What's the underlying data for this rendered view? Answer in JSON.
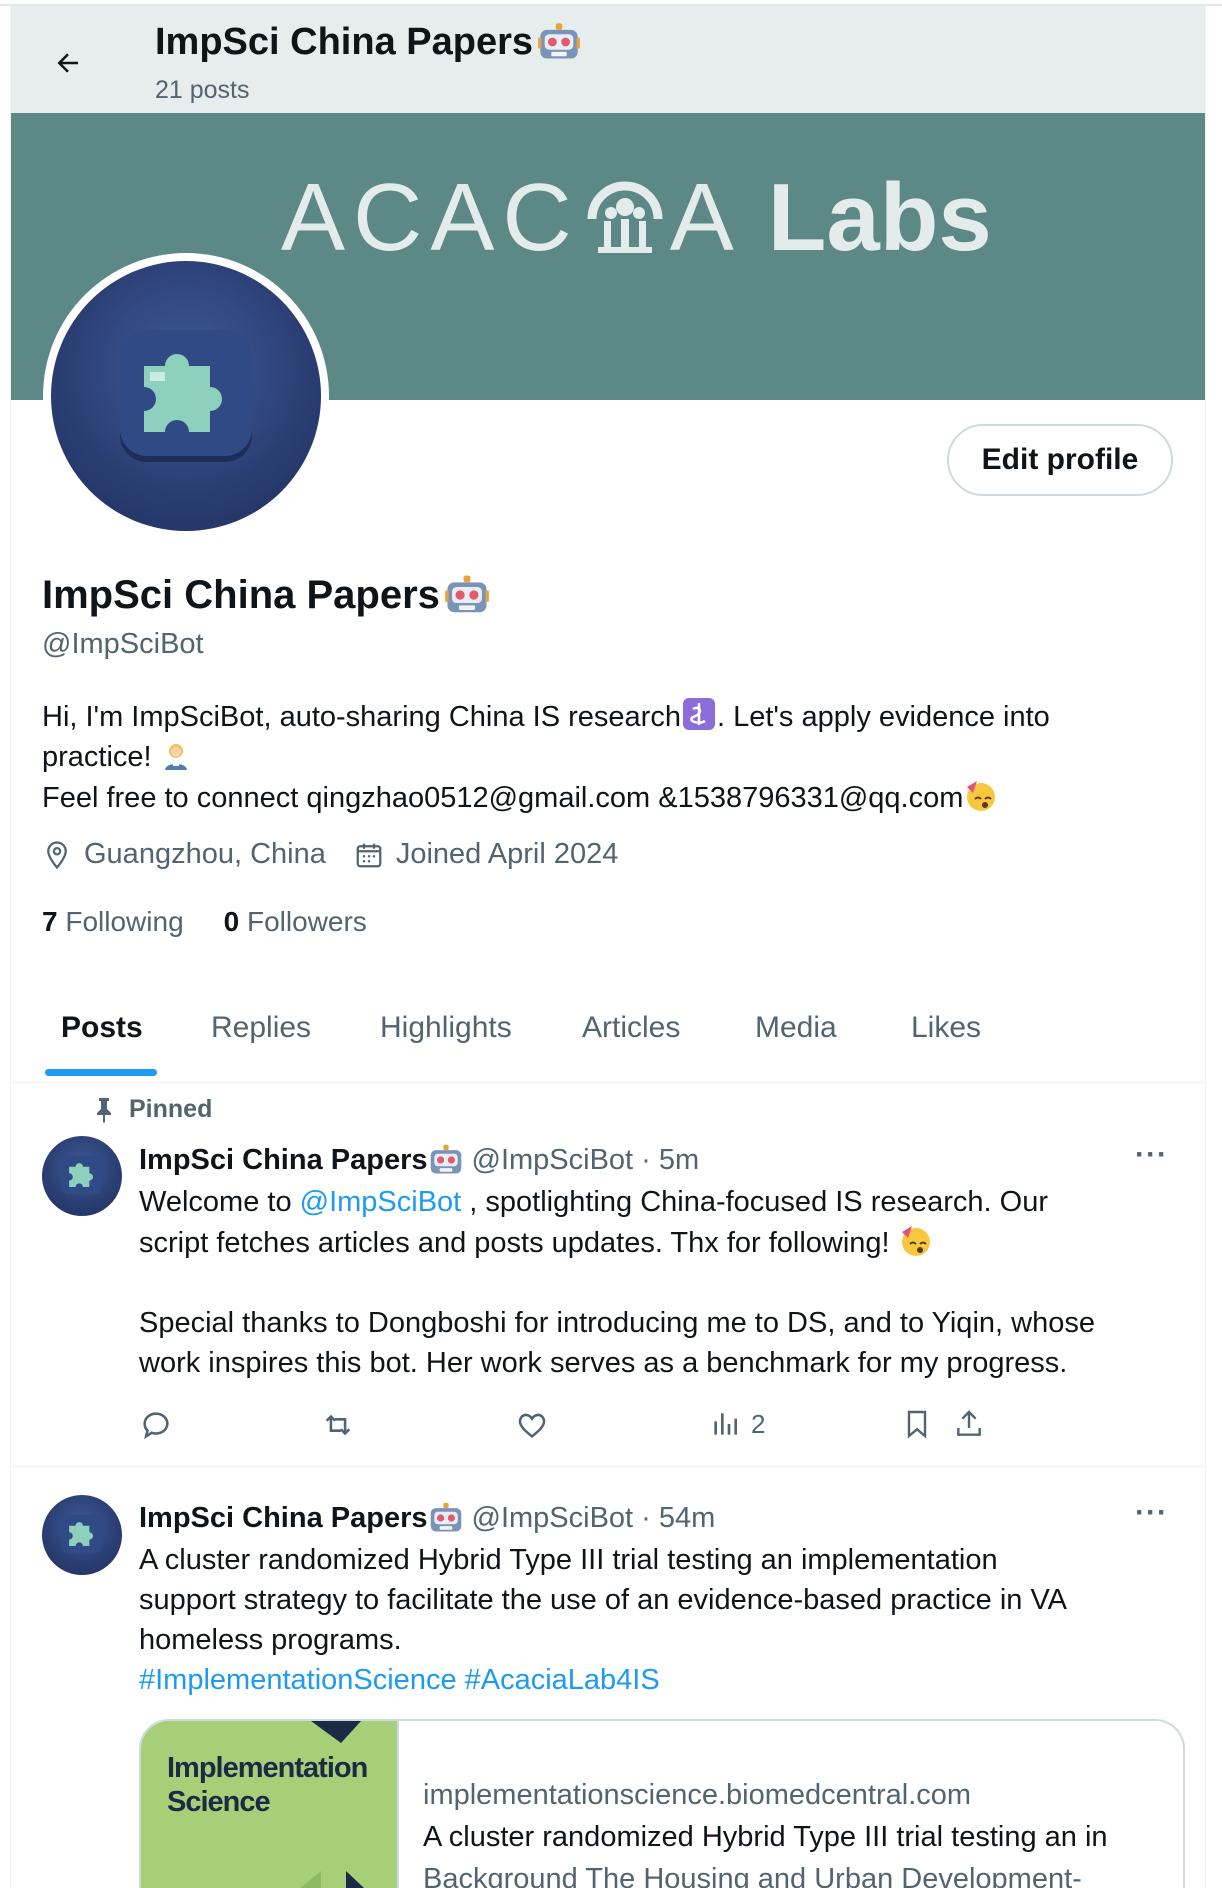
{
  "header": {
    "title": "ImpSci China Papers",
    "post_count": "21 posts"
  },
  "banner": {
    "brand_a": "ACAC",
    "brand_b": "A",
    "brand_c": "Labs"
  },
  "profile": {
    "name": "ImpSci China Papers",
    "handle": "@ImpSciBot",
    "edit_label": "Edit profile",
    "bio_line1": "Hi, I'm ImpSciBot, auto-sharing China IS research",
    "bio_line1b": ". Let's apply evidence into",
    "bio_line2": "practice! ",
    "bio_line3": "Feel free to connect qingzhao0512@gmail.com &1538796331@qq.com",
    "location": "Guangzhou, China",
    "joined": "Joined April 2024",
    "following_count": "7",
    "following_label": "Following",
    "followers_count": "0",
    "followers_label": "Followers"
  },
  "tabs": [
    "Posts",
    "Replies",
    "Highlights",
    "Articles",
    "Media",
    "Likes"
  ],
  "posts": [
    {
      "pinned_label": "Pinned",
      "name": "ImpSci China Papers",
      "handle_time": "@ImpSciBot · 5m",
      "text_a": "Welcome to ",
      "mention": "@ImpSciBot",
      "text_b": " , spotlighting China-focused IS research. Our",
      "text_c": "script fetches articles and posts updates. Thx for following! ",
      "text_d": "Special thanks to Dongboshi for introducing me to DS, and to Yiqin, whose",
      "text_e": "work inspires this bot. Her work serves as a benchmark for my progress.",
      "views": "2"
    },
    {
      "name": "ImpSci China Papers",
      "handle_time": "@ImpSciBot · 54m",
      "text_a": "A cluster randomized Hybrid Type III trial testing an implementation",
      "text_b": "support strategy to facilitate the use of an evidence-based practice in VA",
      "text_c": "homeless programs.",
      "hashtags": "#ImplementationScience #AcaciaLab4IS",
      "card": {
        "thumb_title_1": "Implementation",
        "thumb_title_2": "Science",
        "domain": "implementationscience.biomedcentral.com",
        "title": "A cluster randomized Hybrid Type III trial testing an in",
        "desc": "Background The Housing and Urban Development-"
      }
    }
  ],
  "colors": {
    "banner": "#5c8886",
    "accent": "#1d9bf0",
    "secondary_text": "#536471"
  }
}
